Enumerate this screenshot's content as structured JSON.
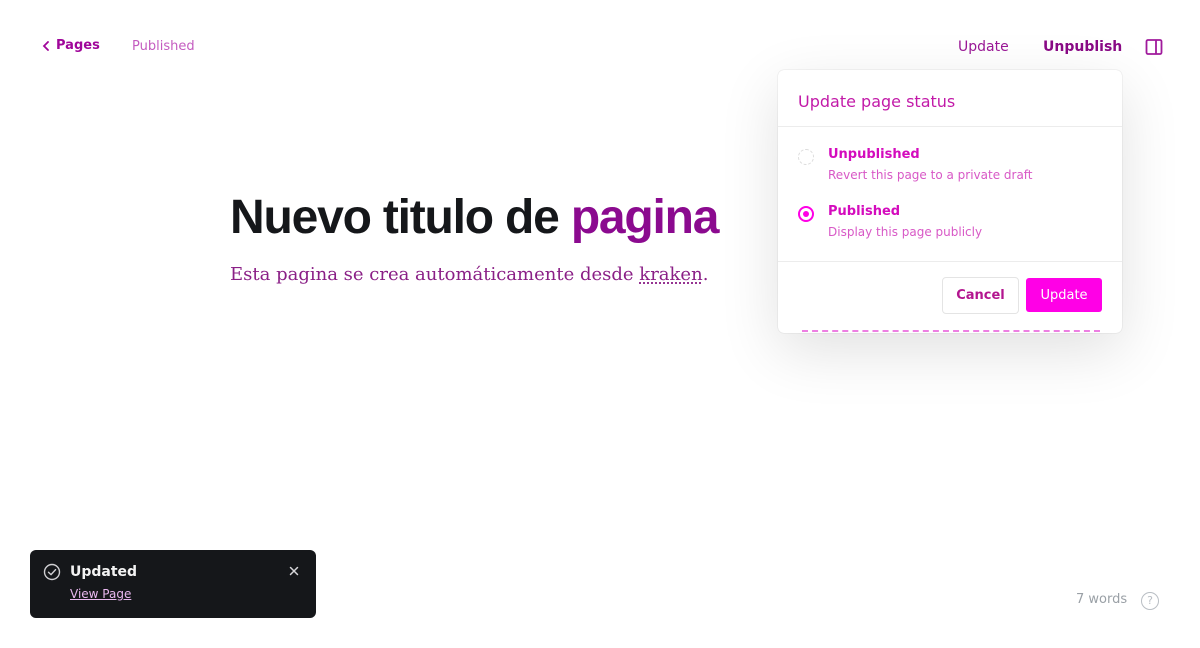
{
  "header": {
    "back_label": "Pages",
    "status_text": "Published",
    "update_label": "Update",
    "unpublish_label": "Unpublish"
  },
  "editor": {
    "title_main": "Nuevo titulo de ",
    "title_tail": "pagina",
    "excerpt_before": "Esta pagina se crea automáticamente desde ",
    "excerpt_link": "kraken",
    "excerpt_after": "."
  },
  "popover": {
    "title": "Update page status",
    "options": [
      {
        "label": "Unpublished",
        "description": "Revert this page to a private draft",
        "selected": false
      },
      {
        "label": "Published",
        "description": "Display this page publicly",
        "selected": true
      }
    ],
    "cancel_label": "Cancel",
    "update_label": "Update"
  },
  "toast": {
    "title": "Updated",
    "link_label": "View Page"
  },
  "footer": {
    "word_count": "7 words",
    "help_glyph": "?"
  },
  "colors": {
    "accent": "#ff00e6",
    "toast_bg": "#15171a"
  },
  "icons": {
    "back": "chevron-left-icon",
    "panel": "sidebar-panel-icon",
    "toast_status": "check-circle-icon",
    "close": "close-icon",
    "help": "help-circle-icon"
  }
}
